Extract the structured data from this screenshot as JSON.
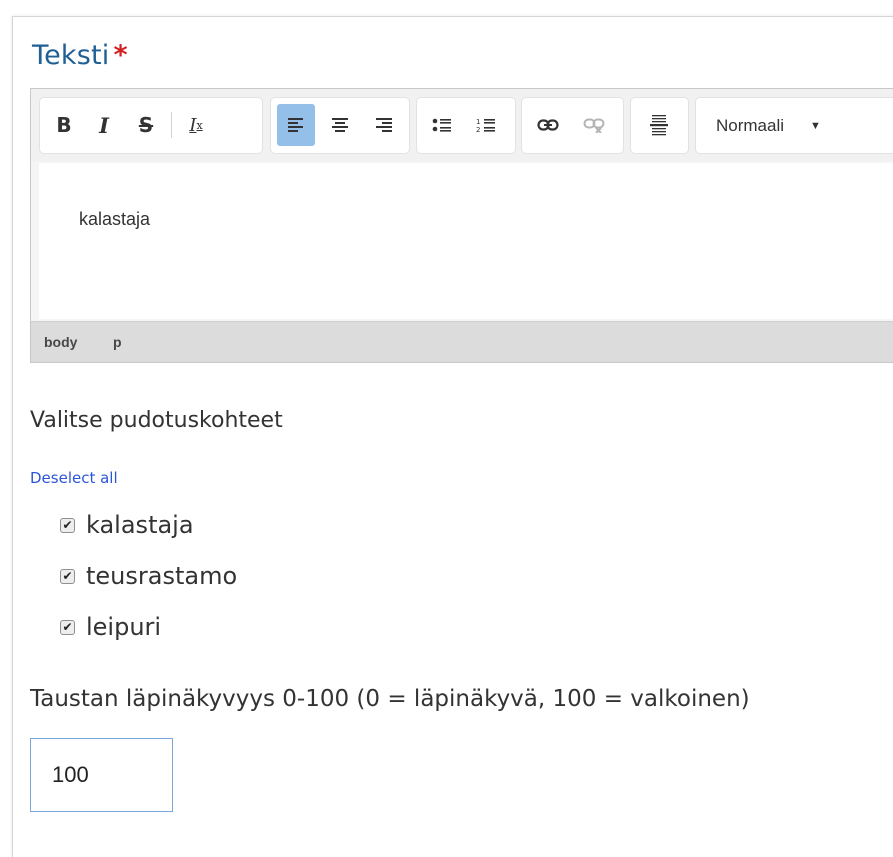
{
  "field": {
    "title": "Teksti",
    "required_mark": "*"
  },
  "editor": {
    "toolbar": {
      "bold": "B",
      "italic": "I",
      "strike": "S",
      "remove_format": "I",
      "remove_format_sub": "x",
      "format_select": "Normaali"
    },
    "content_text": "kalastaja",
    "path": [
      "body",
      "p"
    ]
  },
  "drops": {
    "title": "Valitse pudotuskohteet",
    "deselect_label": "Deselect all",
    "items": [
      {
        "label": "kalastaja",
        "checked": true
      },
      {
        "label": "teusrastamo",
        "checked": true
      },
      {
        "label": "leipuri",
        "checked": true
      }
    ]
  },
  "opacity": {
    "label": "Taustan läpinäkyvyys 0-100 (0 = läpinäkyvä, 100 = valkoinen)",
    "value": "100"
  },
  "colors": {
    "title": "#1f5f93",
    "required": "#d21f1f",
    "link": "#2d55d8",
    "active_button": "#94bfe8"
  }
}
